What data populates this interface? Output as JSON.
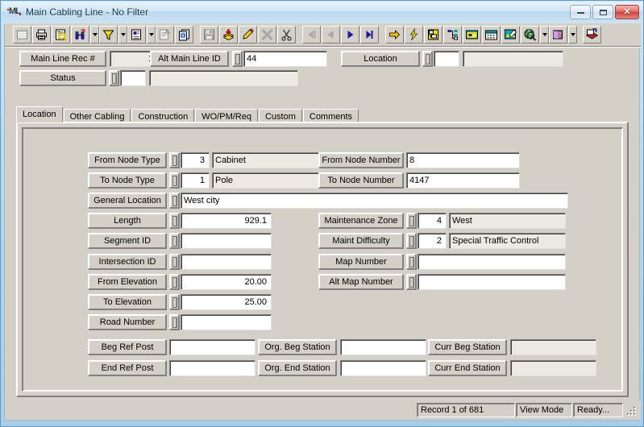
{
  "window": {
    "title": "Main Cabling Line - No Filter",
    "app_icon": "ml-logo-icon",
    "buttons": {
      "minimize": "Minimize",
      "maximize": "Maximize",
      "close": "Close"
    }
  },
  "toolbar": {
    "items": [
      {
        "name": "select-grid-icon",
        "disabled": true
      },
      {
        "name": "print-icon",
        "disabled": false
      },
      {
        "name": "print-preview-icon",
        "disabled": false
      },
      {
        "name": "find-binoculars-icon",
        "disabled": false
      },
      {
        "name": "find-dropdown-arrow-icon",
        "dropdown": true
      },
      {
        "name": "filter-funnel-icon",
        "disabled": false
      },
      {
        "name": "filter-dropdown-arrow-icon",
        "dropdown": true
      },
      {
        "name": "report-icon",
        "disabled": false
      },
      {
        "name": "report-dropdown-arrow-icon",
        "dropdown": true
      },
      {
        "name": "properties-icon",
        "disabled": true
      },
      {
        "name": "copy-record-icon",
        "disabled": false
      },
      {
        "name": "separator",
        "sep": true
      },
      {
        "name": "save-icon",
        "disabled": true
      },
      {
        "name": "add-record-icon",
        "disabled": false
      },
      {
        "name": "edit-pencil-icon",
        "disabled": false
      },
      {
        "name": "delete-x-icon",
        "disabled": true
      },
      {
        "name": "cut-scissors-icon",
        "disabled": false
      },
      {
        "name": "separator",
        "sep": true
      },
      {
        "name": "first-record-icon",
        "disabled": true
      },
      {
        "name": "previous-record-icon",
        "disabled": true
      },
      {
        "name": "next-record-icon",
        "disabled": false
      },
      {
        "name": "last-record-icon",
        "disabled": false
      },
      {
        "name": "separator",
        "sep": true
      },
      {
        "name": "goto-arrow-icon",
        "disabled": false
      },
      {
        "name": "lightning-icon",
        "disabled": false
      },
      {
        "name": "layout-icon",
        "disabled": false
      },
      {
        "name": "tree-view-icon",
        "disabled": false
      },
      {
        "name": "map-window-icon",
        "disabled": false
      },
      {
        "name": "calendar-icon",
        "disabled": false
      },
      {
        "name": "image-edit-icon",
        "disabled": false
      },
      {
        "name": "globe-search-icon",
        "disabled": false
      },
      {
        "name": "globe-dropdown-arrow-icon",
        "dropdown": true
      },
      {
        "name": "help-book-icon",
        "disabled": false
      },
      {
        "name": "help-dropdown-arrow-icon",
        "dropdown": true
      },
      {
        "name": "separator",
        "sep": true
      },
      {
        "name": "export-icon",
        "disabled": false
      }
    ]
  },
  "header": {
    "main_line_rec": {
      "label": "Main Line Rec #",
      "value": "1",
      "readonly": true
    },
    "alt_main_line_id": {
      "label": "Alt Main Line ID",
      "value": "44",
      "readonly": false
    },
    "location": {
      "label": "Location",
      "code": "",
      "desc": ""
    },
    "status": {
      "label": "Status",
      "code": "",
      "desc": ""
    }
  },
  "tabs": [
    {
      "label": "Location",
      "active": true
    },
    {
      "label": "Other Cabling",
      "active": false
    },
    {
      "label": "Construction",
      "active": false
    },
    {
      "label": "WO/PM/Req",
      "active": false
    },
    {
      "label": "Custom",
      "active": false
    },
    {
      "label": "Comments",
      "active": false
    }
  ],
  "location_tab": {
    "left_fields": [
      {
        "label": "From Node Type",
        "code": "3",
        "desc": "Cabinet",
        "lookup": true
      },
      {
        "label": "To Node Type",
        "code": "1",
        "desc": "Pole",
        "lookup": true
      },
      {
        "label": "General Location",
        "value": "West city",
        "wide": true,
        "lookup": true
      },
      {
        "label": "Length",
        "value": "929.1",
        "numeric": true,
        "lookup": true
      },
      {
        "label": "Segment ID",
        "value": "",
        "lookup": true
      },
      {
        "label": "Intersection ID",
        "value": "",
        "lookup": true
      },
      {
        "label": "From Elevation",
        "value": "20.00",
        "numeric": true,
        "lookup": true
      },
      {
        "label": "To Elevation",
        "value": "25.00",
        "numeric": true,
        "lookup": true
      },
      {
        "label": "Road Number",
        "value": "",
        "lookup": true
      }
    ],
    "right_fields": [
      {
        "label": "From Node Number",
        "value": "8",
        "lookup": false
      },
      {
        "label": "To Node Number",
        "value": "4147",
        "lookup": false
      },
      {
        "label": "Maintenance Zone",
        "code": "4",
        "desc": "West",
        "lookup": true
      },
      {
        "label": "Maint Difficulty",
        "code": "2",
        "desc": "Special Traffic Control",
        "lookup": true
      },
      {
        "label": "Map Number",
        "value": "",
        "lookup": true
      },
      {
        "label": "Alt Map Number",
        "value": "",
        "lookup": true
      }
    ],
    "bottom_rows": [
      {
        "col1": {
          "label": "Beg Ref Post",
          "value": "",
          "readonly": false
        },
        "col2": {
          "label": "Org. Beg Station",
          "value": "",
          "readonly": false
        },
        "col3": {
          "label": "Curr Beg Station",
          "value": "",
          "readonly": true
        }
      },
      {
        "col1": {
          "label": "End Ref Post",
          "value": "",
          "readonly": false
        },
        "col2": {
          "label": "Org. End Station",
          "value": "",
          "readonly": false
        },
        "col3": {
          "label": "Curr End Station",
          "value": "",
          "readonly": true
        }
      }
    ]
  },
  "statusbar": {
    "record": "Record 1 of 681",
    "mode": "View Mode",
    "state": "Ready...",
    "grip": "resize-grip-icon"
  },
  "colors": {
    "face": "#d4d0c8",
    "frame": "#a9cde5",
    "title_text": "#16384d",
    "close_red": "#cf4339",
    "field_bg": "#ffffff",
    "readonly_bg": "#ece9e3"
  }
}
